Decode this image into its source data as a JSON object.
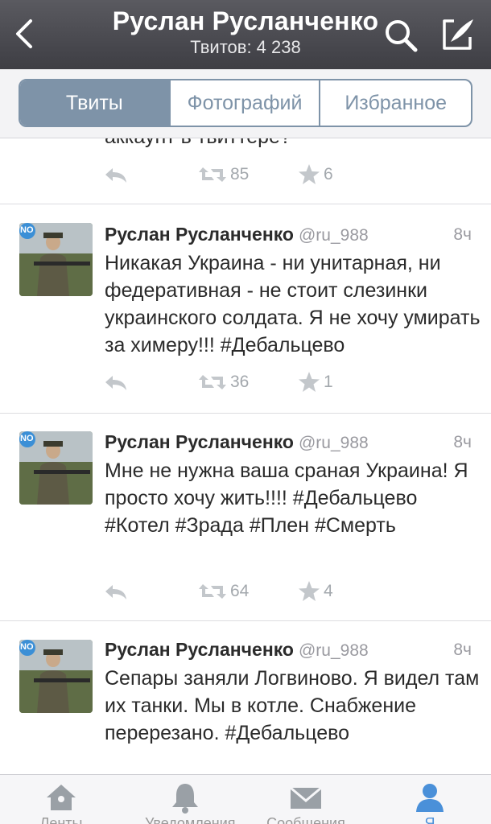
{
  "header": {
    "title": "Руслан Русланченко",
    "subtitle": "Твитов: 4 238"
  },
  "tabs": [
    {
      "label": "Твиты",
      "active": true
    },
    {
      "label": "Фотографий",
      "active": false
    },
    {
      "label": "Избранное",
      "active": false
    }
  ],
  "partial_tweet": {
    "text": "аккаунт в твиттере?",
    "retweets": "85",
    "favorites": "6"
  },
  "tweets": [
    {
      "name": "Руслан Русланченко",
      "handle": "@ru_988",
      "time": "8ч",
      "text": "Никакая Украина - ни унитарная, ни федеративная - не стоит слезинки украинского солдата. Я не хочу умирать за химеру!!! #Дебальцево",
      "retweets": "36",
      "favorites": "1"
    },
    {
      "name": "Руслан Русланченко",
      "handle": "@ru_988",
      "time": "8ч",
      "text": "Мне не нужна ваша сраная Украина! Я просто хочу жить!!!! #Дебальцево #Котел #Зрада #Плен #Смерть",
      "retweets": "64",
      "favorites": "4"
    },
    {
      "name": "Руслан Русланченко",
      "handle": "@ru_988",
      "time": "8ч",
      "text": "Сепары заняли Логвиново. Я видел там их танки. Мы в котле. Снабжение перерезано. #Дебальцево"
    }
  ],
  "avatar_badge": "NO",
  "bottom_tabs": [
    {
      "label": "Ленты",
      "icon": "home-icon"
    },
    {
      "label": "Уведомления",
      "icon": "bell-icon"
    },
    {
      "label": "Сообщения",
      "icon": "envelope-icon"
    },
    {
      "label": "Я",
      "icon": "person-icon"
    }
  ],
  "colors": {
    "header_bg": "#4a4a50",
    "accent": "#7e93a8",
    "active_tab": "#4a90d9",
    "muted": "#a3a8ad"
  }
}
